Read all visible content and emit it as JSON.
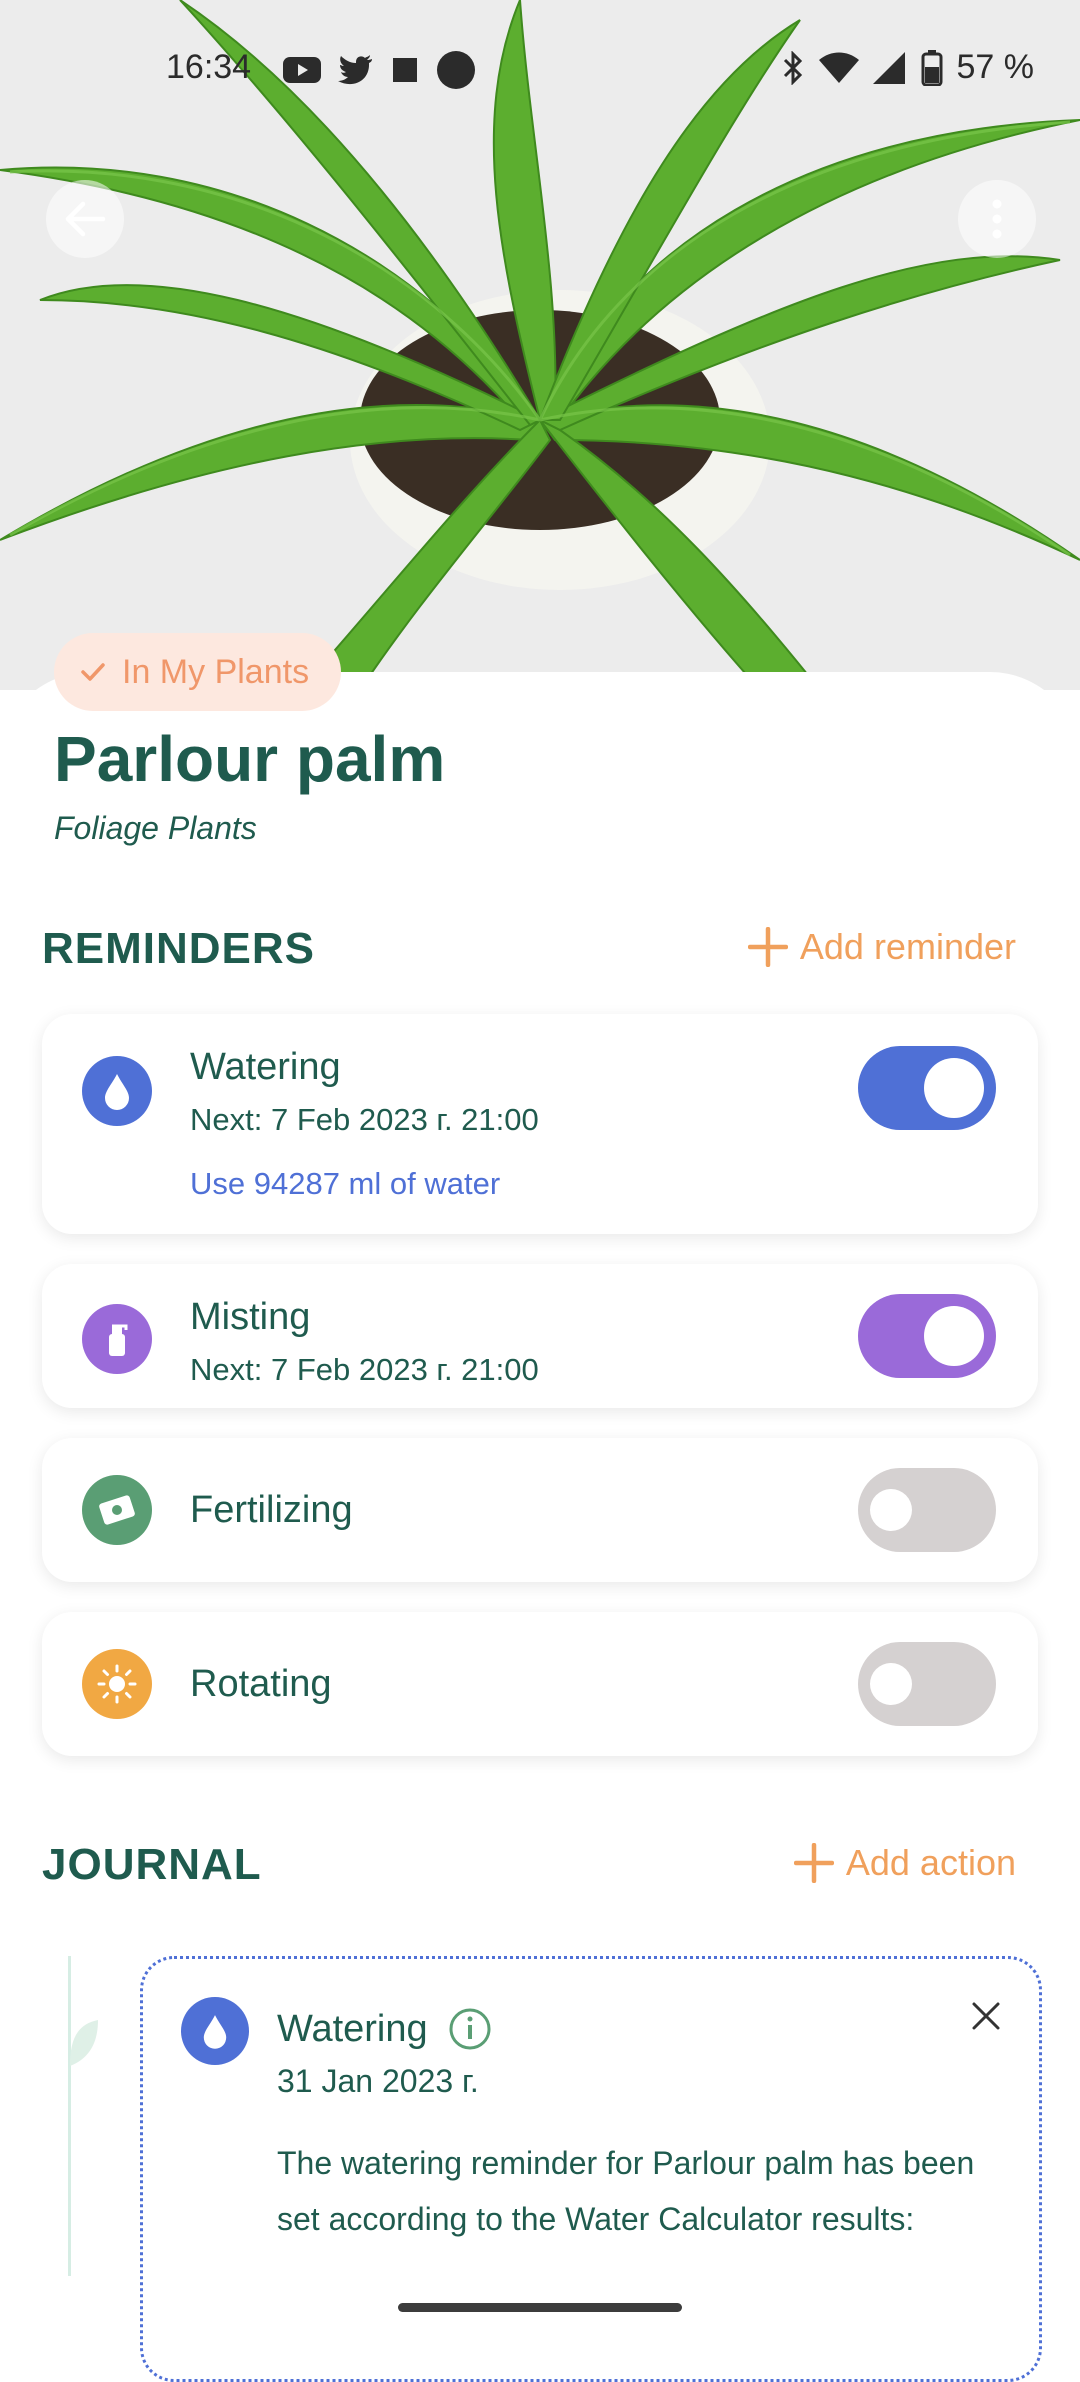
{
  "status_bar": {
    "time": "16:34",
    "battery": "57 %"
  },
  "plant": {
    "badge": "In My Plants",
    "name": "Parlour palm",
    "category": "Foliage Plants"
  },
  "reminders": {
    "heading": "REMINDERS",
    "add_label": "Add reminder",
    "items": [
      {
        "name": "Watering",
        "next": "Next: 7 Feb 2023 г. 21:00",
        "hint": "Use 94287 ml of water",
        "icon": "water-drop-icon",
        "color": "#4f70d6",
        "enabled": true
      },
      {
        "name": "Misting",
        "next": "Next: 7 Feb 2023 г. 21:00",
        "icon": "spray-bottle-icon",
        "color": "#9a6ad9",
        "enabled": true
      },
      {
        "name": "Fertilizing",
        "icon": "fertilizer-icon",
        "color": "#5a9e74",
        "enabled": false
      },
      {
        "name": "Rotating",
        "icon": "sun-icon",
        "color": "#f1a843",
        "enabled": false
      }
    ]
  },
  "journal": {
    "heading": "JOURNAL",
    "add_label": "Add action",
    "entries": [
      {
        "title": "Watering",
        "date": "31 Jan 2023 г.",
        "text": "The watering reminder for Parlour palm has been set according to the Water Calculator results:"
      }
    ]
  },
  "colors": {
    "primary_text": "#1f5b4e",
    "accent": "#f0a05c",
    "water": "#4f70d6",
    "misting": "#9a6ad9",
    "toggle_off": "#d5d1d1"
  }
}
